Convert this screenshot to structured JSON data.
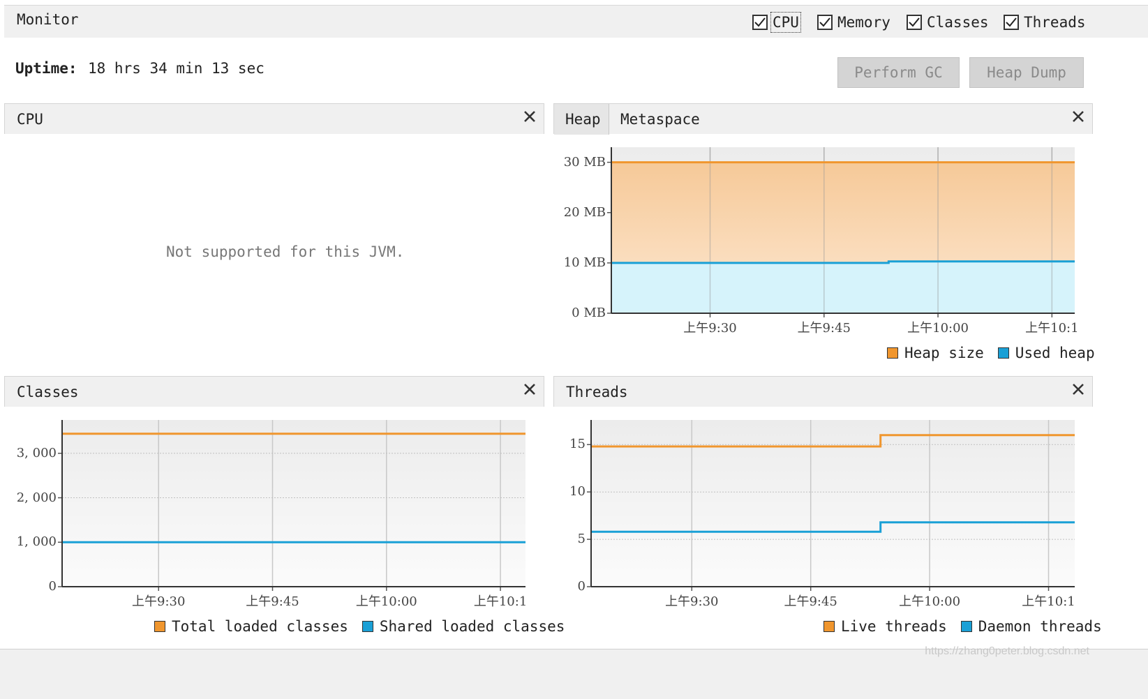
{
  "header": {
    "title": "Monitor",
    "checkboxes": [
      {
        "label": "CPU",
        "checked": true
      },
      {
        "label": "Memory",
        "checked": true
      },
      {
        "label": "Classes",
        "checked": true
      },
      {
        "label": "Threads",
        "checked": true
      }
    ]
  },
  "uptime": {
    "label": "Uptime:",
    "value": "18 hrs 34 min 13 sec"
  },
  "buttons": {
    "perform_gc": "Perform GC",
    "heap_dump": "Heap Dump"
  },
  "cpu_panel": {
    "title": "CPU",
    "message": "Not supported for this JVM."
  },
  "memory_panel": {
    "tabs": [
      "Heap",
      "Metaspace"
    ],
    "active_tab": "Heap"
  },
  "classes_panel": {
    "title": "Classes"
  },
  "threads_panel": {
    "title": "Threads"
  },
  "colors": {
    "orange": "#f0962e",
    "blue": "#1aa0d6",
    "heap_fill_top": "#f6c998",
    "heap_fill_bottom": "#fde8d2",
    "used_fill": "#d6f3fb"
  },
  "watermark": "https://zhang0peter.blog.csdn.net",
  "chart_data": [
    {
      "id": "heap",
      "type": "area",
      "ytick_labels": [
        "0 MB",
        "10 MB",
        "20 MB",
        "30 MB"
      ],
      "yticks": [
        0,
        10,
        20,
        30
      ],
      "ylim": [
        0,
        33
      ],
      "xtick_labels": [
        "上午9:30",
        "上午9:45",
        "上午10:00",
        "上午10:1"
      ],
      "xticks": [
        570,
        585,
        600,
        615
      ],
      "xlim": [
        557,
        618
      ],
      "grid": true,
      "legend_position": "bottom-right",
      "series": [
        {
          "name": "Heap size",
          "color": "#f0962e",
          "x": [
            557,
            618
          ],
          "y": [
            30,
            30
          ]
        },
        {
          "name": "Used heap",
          "color": "#1aa0d6",
          "x": [
            557,
            593.5,
            593.5,
            618
          ],
          "y": [
            10,
            10,
            10.3,
            10.3
          ]
        }
      ]
    },
    {
      "id": "classes",
      "type": "line",
      "ytick_labels": [
        "0",
        "1, 000",
        "2, 000",
        "3, 000"
      ],
      "yticks": [
        0,
        1000,
        2000,
        3000
      ],
      "ylim": [
        0,
        3750
      ],
      "xtick_labels": [
        "上午9:30",
        "上午9:45",
        "上午10:00",
        "上午10:1"
      ],
      "xticks": [
        570,
        585,
        600,
        615
      ],
      "xlim": [
        557.3,
        618.3
      ],
      "grid": true,
      "legend_position": "bottom-right",
      "series": [
        {
          "name": "Total loaded classes",
          "color": "#f0962e",
          "x": [
            557.3,
            618.3
          ],
          "y": [
            3440,
            3440
          ]
        },
        {
          "name": "Shared loaded classes",
          "color": "#1aa0d6",
          "x": [
            557.3,
            618.3
          ],
          "y": [
            1000,
            1000
          ]
        }
      ]
    },
    {
      "id": "threads",
      "type": "line",
      "ytick_labels": [
        "0",
        "5",
        "10",
        "15"
      ],
      "yticks": [
        0,
        5,
        10,
        15
      ],
      "ylim": [
        0,
        17.6
      ],
      "xtick_labels": [
        "上午9:30",
        "上午9:45",
        "上午10:00",
        "上午10:1"
      ],
      "xticks": [
        570,
        585,
        600,
        615
      ],
      "xlim": [
        557.3,
        618.3
      ],
      "grid": true,
      "legend_position": "bottom-right",
      "series": [
        {
          "name": "Live threads",
          "color": "#f0962e",
          "x": [
            557.3,
            593.8,
            593.8,
            618.3
          ],
          "y": [
            14.8,
            14.8,
            16,
            16
          ]
        },
        {
          "name": "Daemon threads",
          "color": "#1aa0d6",
          "x": [
            557.3,
            593.8,
            593.8,
            618.3
          ],
          "y": [
            5.8,
            5.8,
            6.8,
            6.8
          ]
        }
      ]
    }
  ]
}
